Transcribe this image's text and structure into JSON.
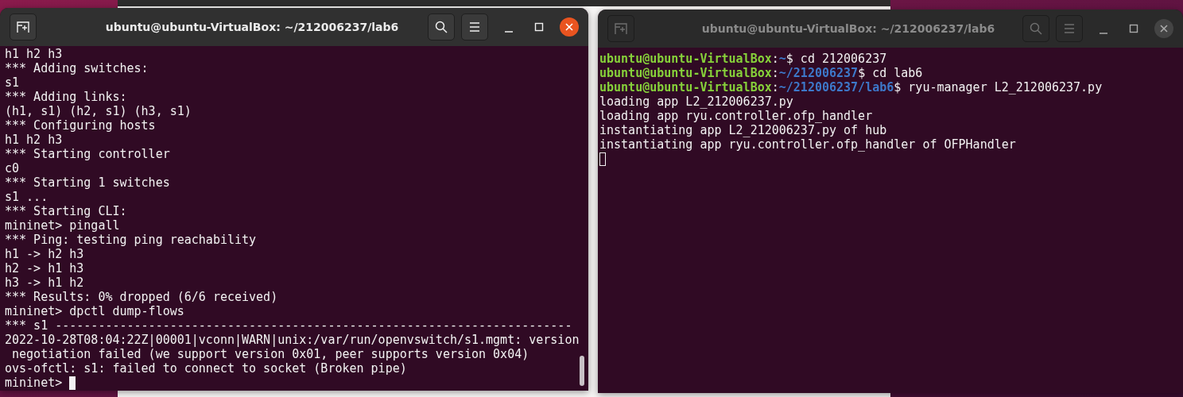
{
  "windows": [
    {
      "title": "ubuntu@ubuntu-VirtualBox: ~/212006237/lab6",
      "focused": true,
      "scrollbar": true,
      "lines": [
        {
          "segments": [
            {
              "kind": "text",
              "text": "h1 h2 h3"
            }
          ]
        },
        {
          "segments": [
            {
              "kind": "text",
              "text": "*** Adding switches:"
            }
          ]
        },
        {
          "segments": [
            {
              "kind": "text",
              "text": "s1"
            }
          ]
        },
        {
          "segments": [
            {
              "kind": "text",
              "text": "*** Adding links:"
            }
          ]
        },
        {
          "segments": [
            {
              "kind": "text",
              "text": "(h1, s1) (h2, s1) (h3, s1)"
            }
          ]
        },
        {
          "segments": [
            {
              "kind": "text",
              "text": "*** Configuring hosts"
            }
          ]
        },
        {
          "segments": [
            {
              "kind": "text",
              "text": "h1 h2 h3"
            }
          ]
        },
        {
          "segments": [
            {
              "kind": "text",
              "text": "*** Starting controller"
            }
          ]
        },
        {
          "segments": [
            {
              "kind": "text",
              "text": "c0"
            }
          ]
        },
        {
          "segments": [
            {
              "kind": "text",
              "text": "*** Starting 1 switches"
            }
          ]
        },
        {
          "segments": [
            {
              "kind": "text",
              "text": "s1 ..."
            }
          ]
        },
        {
          "segments": [
            {
              "kind": "text",
              "text": "*** Starting CLI:"
            }
          ]
        },
        {
          "segments": [
            {
              "kind": "text",
              "text": "mininet> pingall"
            }
          ]
        },
        {
          "segments": [
            {
              "kind": "text",
              "text": "*** Ping: testing ping reachability"
            }
          ]
        },
        {
          "segments": [
            {
              "kind": "text",
              "text": "h1 -> h2 h3"
            }
          ]
        },
        {
          "segments": [
            {
              "kind": "text",
              "text": "h2 -> h1 h3"
            }
          ]
        },
        {
          "segments": [
            {
              "kind": "text",
              "text": "h3 -> h1 h2"
            }
          ]
        },
        {
          "segments": [
            {
              "kind": "text",
              "text": "*** Results: 0% dropped (6/6 received)"
            }
          ]
        },
        {
          "segments": [
            {
              "kind": "text",
              "text": "mininet> dpctl dump-flows"
            }
          ]
        },
        {
          "segments": [
            {
              "kind": "text",
              "text": "*** s1 ------------------------------------------------------------------------"
            }
          ]
        },
        {
          "segments": [
            {
              "kind": "text",
              "text": "2022-10-28T08:04:22Z|00001|vconn|WARN|unix:/var/run/openvswitch/s1.mgmt: version"
            }
          ]
        },
        {
          "segments": [
            {
              "kind": "text",
              "text": " negotiation failed (we support version 0x01, peer supports version 0x04)"
            }
          ]
        },
        {
          "segments": [
            {
              "kind": "text",
              "text": "ovs-ofctl: s1: failed to connect to socket (Broken pipe)"
            }
          ]
        },
        {
          "segments": [
            {
              "kind": "text",
              "text": "mininet> "
            }
          ],
          "cursor": {
            "filled": true
          }
        }
      ]
    },
    {
      "title": "ubuntu@ubuntu-VirtualBox: ~/212006237/lab6",
      "focused": false,
      "scrollbar": false,
      "lines": [
        {
          "segments": [
            {
              "kind": "user",
              "text": "ubuntu@ubuntu-VirtualBox"
            },
            {
              "kind": "text",
              "text": ":"
            },
            {
              "kind": "path",
              "text": "~"
            },
            {
              "kind": "text",
              "text": "$ cd 212006237"
            }
          ]
        },
        {
          "segments": [
            {
              "kind": "user",
              "text": "ubuntu@ubuntu-VirtualBox"
            },
            {
              "kind": "text",
              "text": ":"
            },
            {
              "kind": "path",
              "text": "~/212006237"
            },
            {
              "kind": "text",
              "text": "$ cd lab6"
            }
          ]
        },
        {
          "segments": [
            {
              "kind": "user",
              "text": "ubuntu@ubuntu-VirtualBox"
            },
            {
              "kind": "text",
              "text": ":"
            },
            {
              "kind": "path",
              "text": "~/212006237/lab6"
            },
            {
              "kind": "text",
              "text": "$ ryu-manager L2_212006237.py"
            }
          ]
        },
        {
          "segments": [
            {
              "kind": "text",
              "text": "loading app L2_212006237.py"
            }
          ]
        },
        {
          "segments": [
            {
              "kind": "text",
              "text": "loading app ryu.controller.ofp_handler"
            }
          ]
        },
        {
          "segments": [
            {
              "kind": "text",
              "text": "instantiating app L2_212006237.py of hub"
            }
          ]
        },
        {
          "segments": [
            {
              "kind": "text",
              "text": "instantiating app ryu.controller.ofp_handler of OFPHandler"
            }
          ]
        },
        {
          "cursor": {
            "filled": false
          }
        }
      ]
    }
  ]
}
